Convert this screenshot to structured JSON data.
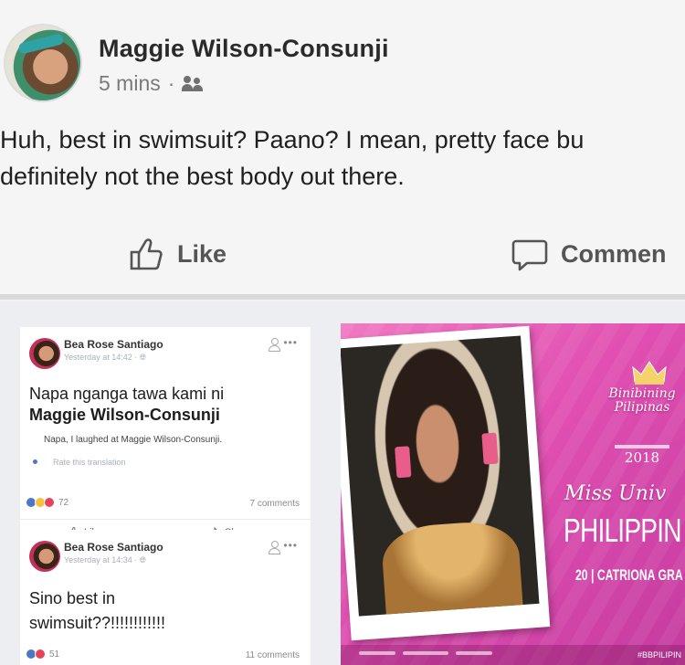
{
  "top_post": {
    "author": "Maggie Wilson-Consunji",
    "time": "5 mins",
    "separator": "·",
    "privacy_icon": "friends-icon",
    "text_line1": "Huh, best in swimsuit? Paano? I mean, pretty face bu",
    "text_line2": "definitely not the best body out there.",
    "like_label": "Like",
    "comment_label": "Commen"
  },
  "comments": [
    {
      "author": "Bea Rose Santiago",
      "time": "Yesterday at 14:42 ·",
      "body_line1": "Napa nganga tawa kami ni",
      "body_line2": "Maggie Wilson-Consunji",
      "translation": "Napa, I laughed at Maggie Wilson-Consunji.",
      "rate_label": "Rate this translation",
      "reaction_count": "72",
      "comment_count": "7 comments",
      "like_label": "Like",
      "share_label": "Share"
    },
    {
      "author": "Bea Rose Santiago",
      "time": "Yesterday at 14:34 ·",
      "body_line1": "Sino best in",
      "body_line2": "swimsuit??!!!!!!!!!!!!",
      "reaction_count": "51",
      "comment_count": "11 comments"
    }
  ],
  "poster": {
    "logo_line1": "Binibining",
    "logo_line2": "Pilipinas",
    "year": "2018",
    "title": "Miss Univ",
    "country": "PHILIPPIN",
    "candidate": "20 | CATRIONA GRA",
    "hashtag": "#BBPILIPIN"
  },
  "colors": {
    "poster_pink": "#e04fb1",
    "reaction_blue": "#4a78c4",
    "reaction_red": "#e8425a",
    "reaction_yellow": "#f5c33b"
  }
}
